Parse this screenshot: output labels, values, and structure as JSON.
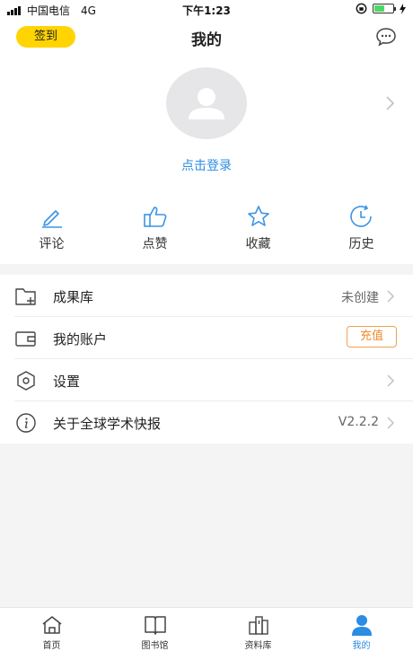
{
  "status_bar": {
    "carrier": "中国电信",
    "network": "4G",
    "time": "下午1:23"
  },
  "header": {
    "checkin_label": "签到",
    "title": "我的"
  },
  "profile": {
    "login_text": "点击登录"
  },
  "quick_actions": [
    {
      "label": "评论",
      "icon": "pencil-icon"
    },
    {
      "label": "点赞",
      "icon": "thumbs-up-icon"
    },
    {
      "label": "收藏",
      "icon": "star-icon"
    },
    {
      "label": "历史",
      "icon": "history-clock-icon"
    }
  ],
  "menu": [
    {
      "label": "成果库",
      "value": "未创建",
      "icon": "folder-add-icon"
    },
    {
      "label": "我的账户",
      "button": "充值",
      "icon": "wallet-icon"
    },
    {
      "label": "设置",
      "icon": "settings-hexagon-icon"
    },
    {
      "label": "关于全球学术快报",
      "value": "V2.2.2",
      "icon": "info-icon"
    }
  ],
  "tab_bar": [
    {
      "label": "首页",
      "icon": "home-icon"
    },
    {
      "label": "图书馆",
      "icon": "book-icon"
    },
    {
      "label": "资料库",
      "icon": "archive-icon"
    },
    {
      "label": "我的",
      "icon": "user-icon",
      "active": true
    }
  ],
  "colors": {
    "accent": "#2b8ce3",
    "checkin": "#ffd400",
    "recharge": "#ef8a2c"
  }
}
